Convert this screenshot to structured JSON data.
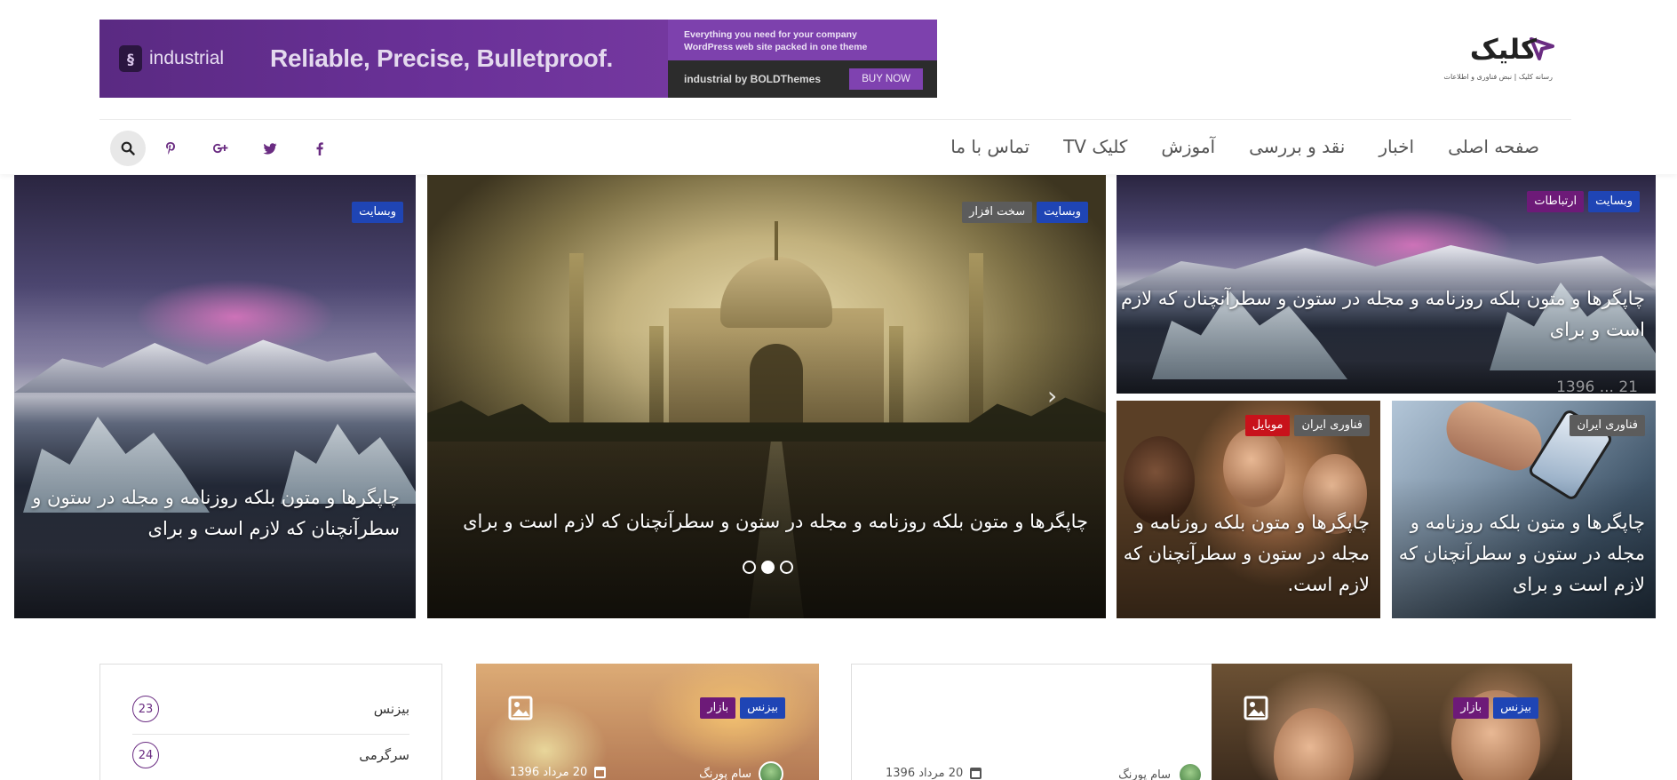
{
  "ad": {
    "brand": "industrial",
    "logo_glyph": "§",
    "slogan": "Reliable, Precise, Bulletproof.",
    "tagline_line1": "Everything you need for your company",
    "tagline_line2": "WordPress web site packed in one theme",
    "by_text": "industrial by BOLDThemes",
    "buy_label": "BUY NOW"
  },
  "logo": {
    "name": "کلیک",
    "tagline": "رسانه کلیک | نبض فناوری و اطلاعات"
  },
  "nav": {
    "items": [
      "صفحه اصلی",
      "اخبار",
      "نقد و بررسی",
      "آموزش",
      "TV کلیک",
      "تماس با ما"
    ]
  },
  "social": {
    "icons": [
      "facebook-icon",
      "twitter-icon",
      "google-plus-icon",
      "pinterest-icon",
      "search-icon"
    ],
    "glyphs": {
      "facebook": "f",
      "twitter": "t",
      "google_plus": "g+",
      "pinterest": "p"
    }
  },
  "hero": {
    "left": {
      "badges": [
        "وبسایت"
      ],
      "title": "چاپگرها و متون بلکه روزنامه و مجله در ستون و سطرآنچنان که لازم است و برای"
    },
    "center": {
      "badges": [
        "وبسایت",
        "سخت افزار"
      ],
      "title": "چاپگرها و متون بلکه روزنامه و مجله در ستون و سطرآنچنان که لازم است و برای",
      "arrow": "›"
    },
    "right_top": {
      "badges": [
        "وبسایت",
        "ارتباطات"
      ],
      "title": "چاپگرها و متون بلکه روزنامه و مجله در ستون و سطرآنچنان که لازم است و برای",
      "date_partial": "21 ... 1396"
    },
    "right_bottom_right": {
      "badges": [
        "فناوری ایران"
      ],
      "title": "چاپگرها و متون بلکه روزنامه و مجله در ستون و سطرآنچنان که لازم است و برای"
    },
    "right_bottom_left": {
      "badges": [
        "فناوری ایران",
        "موبایل"
      ],
      "title": "چاپگرها و متون بلکه روزنامه و مجله در ستون و سطرآنچنان که لازم است."
    }
  },
  "categories": [
    {
      "name": "بیزنس",
      "count": "23"
    },
    {
      "name": "سرگرمی",
      "count": "24"
    }
  ],
  "cards": {
    "middle": {
      "badges": [
        "بیزنس",
        "بازار"
      ],
      "author": "سام پورنگ",
      "date": "20 مرداد 1396"
    },
    "right": {
      "badges": [
        "بیزنس",
        "بازار"
      ],
      "author": "سام پورنگ",
      "date": "20 مرداد 1396"
    }
  },
  "colors": {
    "accent": "#6a2c82",
    "badge_blue": "#1f45b5",
    "badge_purple": "#6d1a78",
    "badge_gray": "#5c5c5c",
    "badge_red": "#c8121b"
  }
}
